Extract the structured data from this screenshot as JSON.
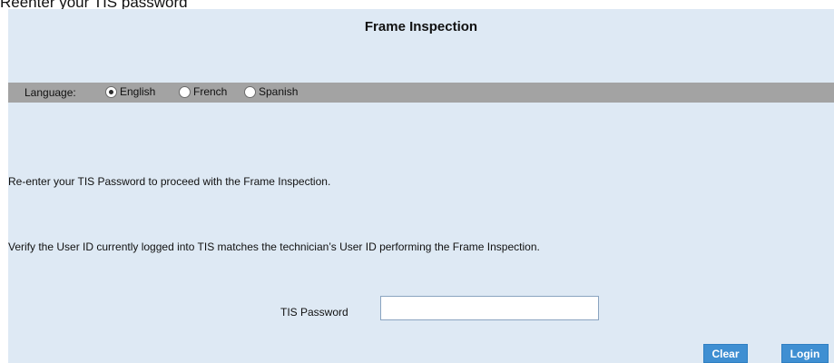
{
  "caption": "Reenter your TIS password",
  "dialog": {
    "title": "Frame Inspection",
    "language": {
      "label": "Language:",
      "options": [
        "English",
        "French",
        "Spanish"
      ],
      "selected": "English"
    },
    "messages": {
      "reenter": "Re-enter your TIS Password to proceed with the Frame Inspection.",
      "verify": "Verify the User ID currently logged into TIS matches the technician’s User ID performing the Frame Inspection."
    },
    "password": {
      "label": "TIS Password",
      "value": ""
    },
    "buttons": {
      "clear": "Clear",
      "login": "Login"
    }
  },
  "colors": {
    "panel_bg": "#dee9f4",
    "language_bar": "#a3a3a3",
    "button_blue": "#3f8fd2"
  }
}
